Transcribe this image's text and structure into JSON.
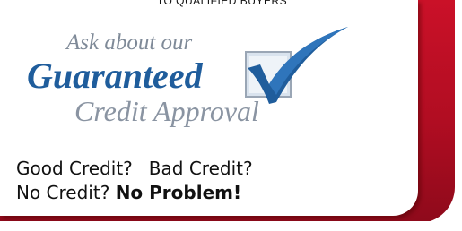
{
  "top_text": "TO QUALIFIED BUYERS",
  "logo": {
    "line1": "Ask about our",
    "line2": "Guaranteed",
    "line3": "Credit Approval",
    "icon": "checkmark-box-icon"
  },
  "message": {
    "good": "Good Credit?",
    "bad": "Bad Credit?",
    "no_credit": "No Credit?",
    "no_problem": "No Problem!"
  },
  "colors": {
    "red": "#c8102e",
    "blue": "#1f5d9c",
    "gray": "#8a94a2"
  }
}
